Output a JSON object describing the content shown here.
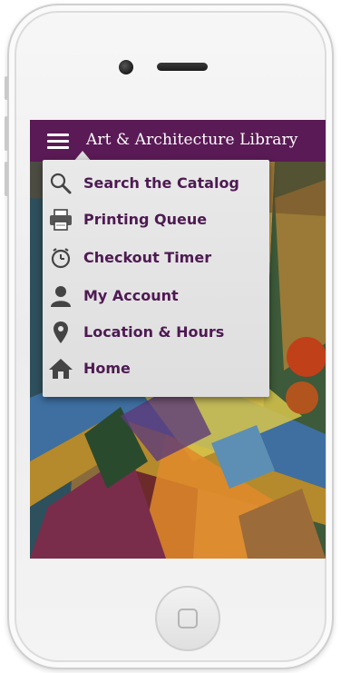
{
  "app": {
    "title": "Art & Architecture Library"
  },
  "menu": {
    "items": [
      {
        "label": "Search the Catalog",
        "icon": "search-icon"
      },
      {
        "label": "Printing Queue",
        "icon": "printer-icon"
      },
      {
        "label": "Checkout Timer",
        "icon": "timer-icon"
      },
      {
        "label": "My Account",
        "icon": "user-icon"
      },
      {
        "label": "Location & Hours",
        "icon": "location-pin-icon"
      },
      {
        "label": "Home",
        "icon": "house-icon"
      }
    ]
  },
  "colors": {
    "app_bar": "#5a1a55",
    "menu_text": "#4e1a52",
    "menu_background": "#e4e4e4"
  }
}
